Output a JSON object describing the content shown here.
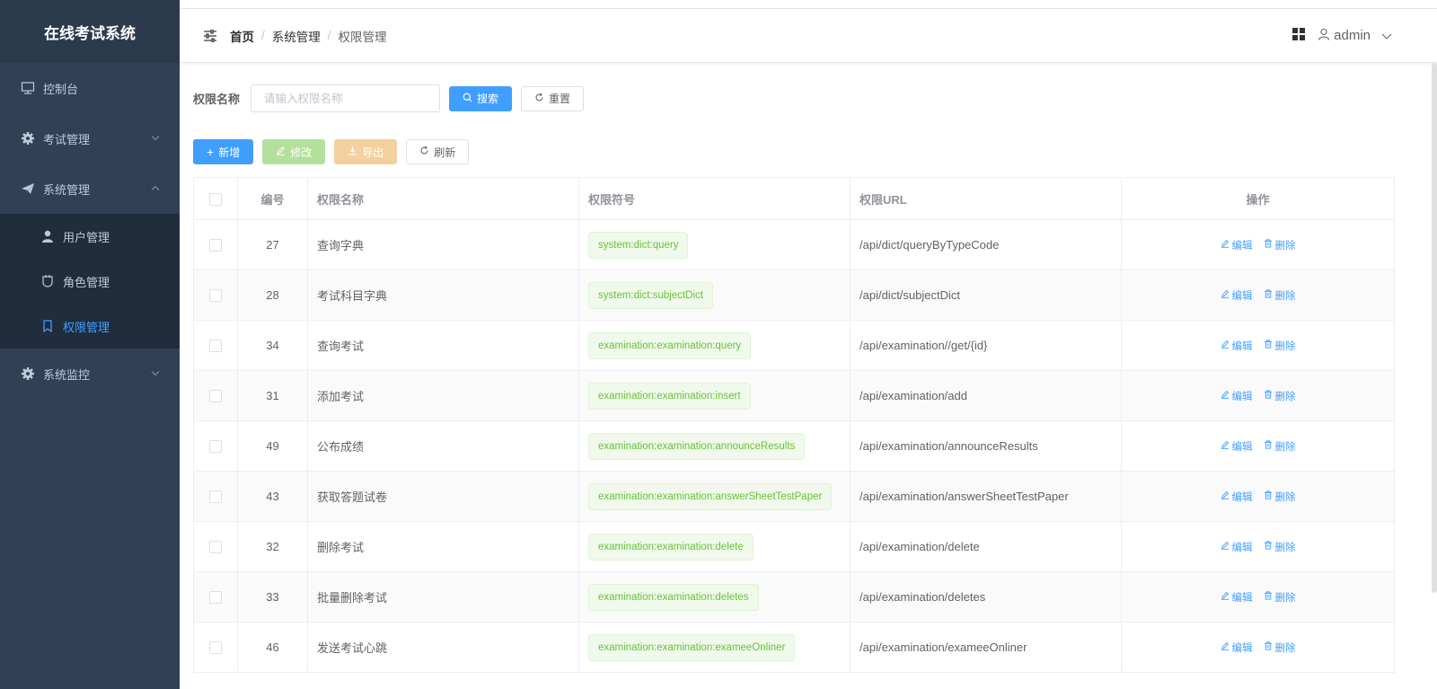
{
  "sidebar": {
    "title": "在线考试系统",
    "items": [
      {
        "label": "控制台",
        "icon": "monitor-icon"
      },
      {
        "label": "考试管理",
        "icon": "gear-icon"
      },
      {
        "label": "系统管理",
        "icon": "paper-plane-icon"
      },
      {
        "label": "系统监控",
        "icon": "gear-icon"
      }
    ],
    "submenu": [
      {
        "label": "用户管理",
        "icon": "user-icon"
      },
      {
        "label": "角色管理",
        "icon": "cup-icon"
      },
      {
        "label": "权限管理",
        "icon": "bookmark-icon"
      }
    ]
  },
  "header": {
    "breadcrumb": [
      "首页",
      "系统管理",
      "权限管理"
    ],
    "user": "admin"
  },
  "search": {
    "label": "权限名称",
    "placeholder": "请输入权限名称",
    "search_btn": "搜索",
    "reset_btn": "重置"
  },
  "toolbar": {
    "add": "新增",
    "edit": "修改",
    "export": "导出",
    "refresh": "刷新"
  },
  "table": {
    "headers": [
      "编号",
      "权限名称",
      "权限符号",
      "权限URL",
      "操作"
    ],
    "edit_label": "编辑",
    "delete_label": "删除",
    "rows": [
      {
        "id": "27",
        "name": "查询字典",
        "symbol": "system:dict:query",
        "url": "/api/dict/queryByTypeCode"
      },
      {
        "id": "28",
        "name": "考试科目字典",
        "symbol": "system:dict:subjectDict",
        "url": "/api/dict/subjectDict"
      },
      {
        "id": "34",
        "name": "查询考试",
        "symbol": "examination:examination:query",
        "url": "/api/examination//get/{id}"
      },
      {
        "id": "31",
        "name": "添加考试",
        "symbol": "examination:examination:insert",
        "url": "/api/examination/add"
      },
      {
        "id": "49",
        "name": "公布成绩",
        "symbol": "examination:examination:announceResults",
        "url": "/api/examination/announceResults"
      },
      {
        "id": "43",
        "name": "获取答题试卷",
        "symbol": "examination:examination:answerSheetTestPaper",
        "url": "/api/examination/answerSheetTestPaper"
      },
      {
        "id": "32",
        "name": "删除考试",
        "symbol": "examination:examination:delete",
        "url": "/api/examination/delete"
      },
      {
        "id": "33",
        "name": "批量删除考试",
        "symbol": "examination:examination:deletes",
        "url": "/api/examination/deletes"
      },
      {
        "id": "46",
        "name": "发送考试心跳",
        "symbol": "examination:examination:exameeOnliner",
        "url": "/api/examination/exameeOnliner"
      }
    ]
  }
}
